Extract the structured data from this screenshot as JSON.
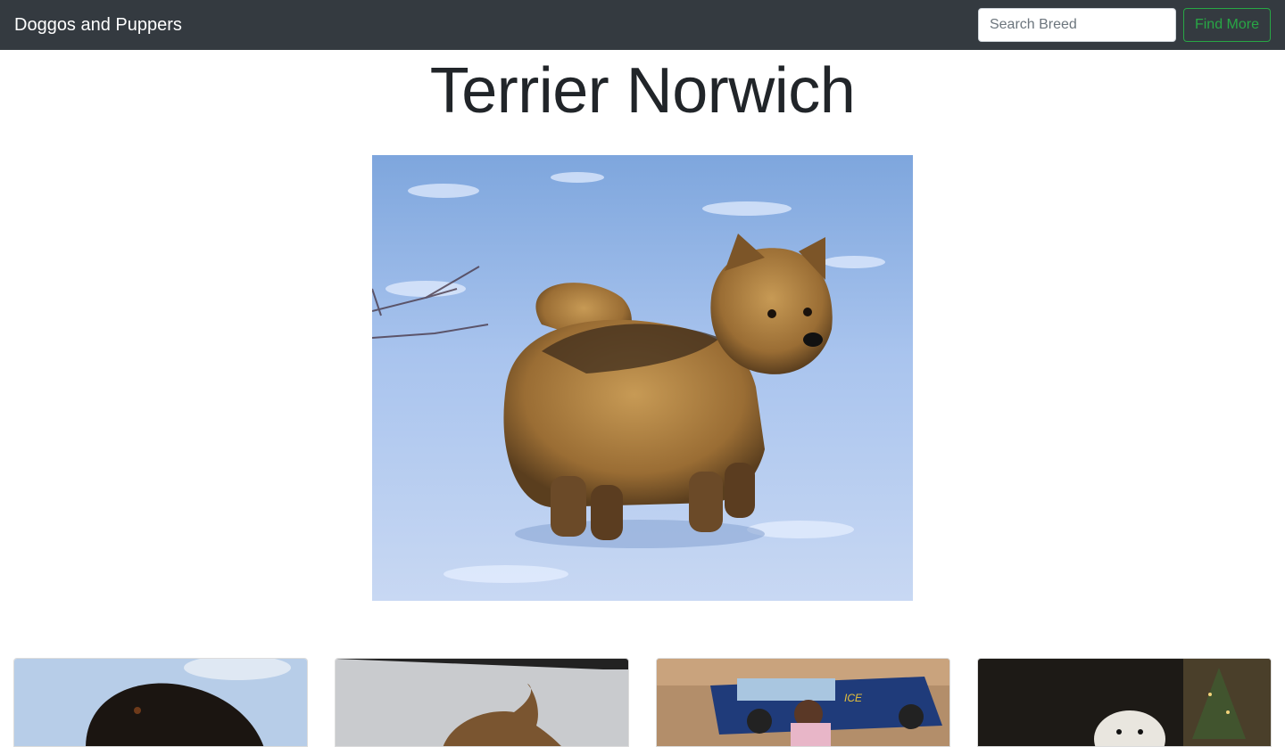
{
  "navbar": {
    "brand": "Doggos and Puppers",
    "search_placeholder": "Search Breed",
    "search_value": "",
    "find_button_label": "Find More",
    "accent_color": "#28a745",
    "background_color": "#343a40"
  },
  "main": {
    "breed_title": "Terrier Norwich",
    "hero_image": "norwich-terrier-in-snow-photo",
    "gallery": [
      {
        "image": "black-dog-outdoors-sky-photo"
      },
      {
        "image": "tan-dog-white-studio-photo"
      },
      {
        "image": "woman-with-dog-by-police-truck-photo"
      },
      {
        "image": "white-fluffy-dog-christmas-tree-photo"
      }
    ]
  }
}
